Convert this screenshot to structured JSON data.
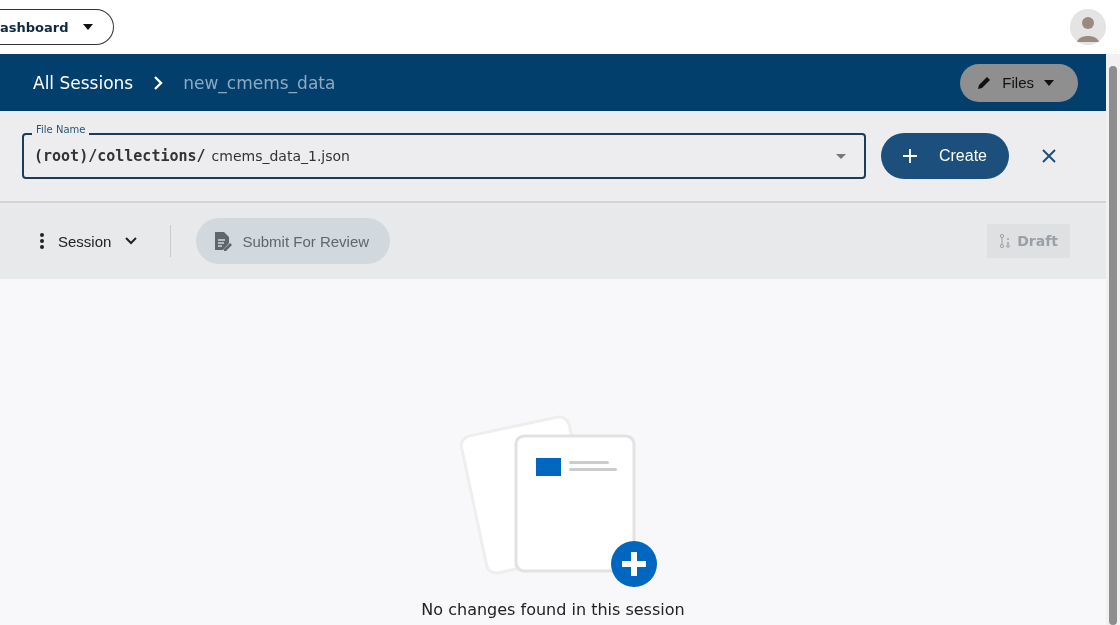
{
  "top_bar": {
    "dashboard_menu": {
      "label": "ashboard"
    }
  },
  "header": {
    "breadcrumbs": [
      {
        "label": "All Sessions",
        "current": false
      },
      {
        "label": "new_cmems_data",
        "current": true
      }
    ],
    "files_button": {
      "label": "Files"
    }
  },
  "file_form": {
    "label": "File Name",
    "prefix": "(root)/collections/",
    "value": "cmems_data_1.json",
    "create_button": {
      "label": "Create"
    }
  },
  "toolbar": {
    "session_menu": {
      "label": "Session"
    },
    "submit_button": {
      "label": "Submit For Review",
      "disabled": true
    },
    "draft_button": {
      "label": "Draft",
      "disabled": true
    }
  },
  "empty_state": {
    "message": "No changes found in this session"
  }
}
